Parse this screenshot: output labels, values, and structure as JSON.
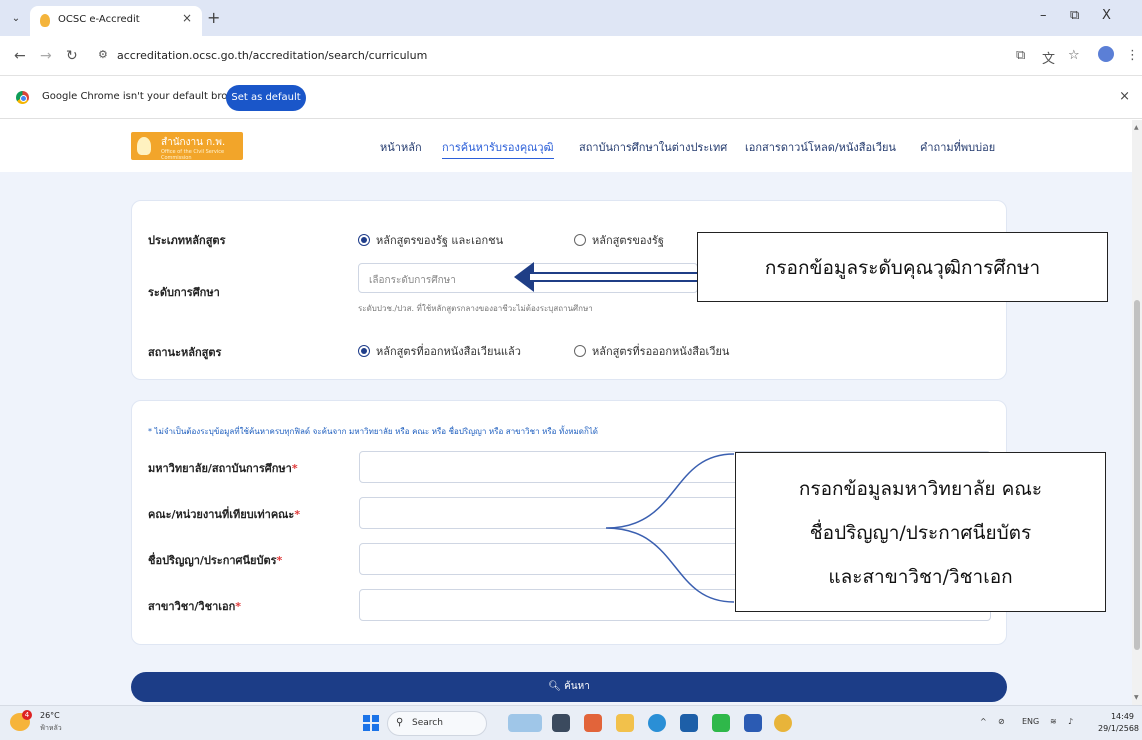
{
  "browser": {
    "tab_title": "OCSC e-Accredit",
    "new_tab": "+",
    "close_tab": "×",
    "url": "accreditation.ocsc.go.th/accreditation/search/curriculum",
    "minimize": "–",
    "restore": "⧉",
    "close": "X"
  },
  "infobar": {
    "message": "Google Chrome isn't your default browser",
    "button": "Set as default",
    "close": "×"
  },
  "site": {
    "logo_name": "สำนักงาน ก.พ.",
    "logo_sub": "Office of the Civil Service Commission",
    "menu": [
      "หน้าหลัก",
      "การค้นหารับรองคุณวุฒิ",
      "สถาบันการศึกษาในต่างประเทศ",
      "เอกสารดาวน์โหลด/หนังสือเวียน",
      "คำถามที่พบบ่อย"
    ]
  },
  "form1": {
    "curriculum_type_label": "ประเภทหลักสูตร",
    "curriculum_type_options": [
      "หลักสูตรของรัฐ และเอกชน",
      "หลักสูตรของรัฐ"
    ],
    "level_label": "ระดับการศึกษา",
    "level_placeholder": "เลือกระดับการศึกษา",
    "level_hint": "ระดับปวช./ปวส. ที่ใช้หลักสูตรกลางของอาชีวะไม่ต้องระบุสถานศึกษา",
    "status_label": "สถานะหลักสูตร",
    "status_options": [
      "หลักสูตรที่ออกหนังสือเวียนแล้ว",
      "หลักสูตรที่รอออกหนังสือเวียน"
    ]
  },
  "form2": {
    "note": "* ไม่จำเป็นต้องระบุข้อมูลที่ใช้ค้นหาครบทุกฟิลด์ จะค้นจาก มหาวิทยาลัย หรือ คณะ หรือ ชื่อปริญญา หรือ สาขาวิชา หรือ ทั้งหมดก็ได้",
    "university_label": "มหาวิทยาลัย/สถาบันการศึกษา",
    "faculty_label": "คณะ/หน่วยงานที่เทียบเท่าคณะ",
    "degree_label": "ชื่อปริญญา/ประกาศนียบัตร",
    "major_label": "สาขาวิชา/วิชาเอก",
    "required_mark": "*"
  },
  "search_button": "ค้นหา",
  "annotations": {
    "callout1": "กรอกข้อมูลระดับคุณวุฒิการศึกษา",
    "callout2_lines": [
      "กรอกข้อมูลมหาวิทยาลัย คณะ",
      "ชื่อปริญญา/ประกาศนียบัตร",
      "และสาขาวิชา/วิชาเอก"
    ]
  },
  "taskbar": {
    "temperature": "26°C",
    "condition": "ฟ้าหลัว",
    "weather_badge": "4",
    "search": "Search",
    "lang": "ENG",
    "time": "14:49",
    "date": "29/1/2568"
  },
  "colors": {
    "accent": "#2b5fd9",
    "primary_button": "#1c3d87",
    "page_bg": "#eff3fb",
    "logo": "#f2a52a"
  }
}
